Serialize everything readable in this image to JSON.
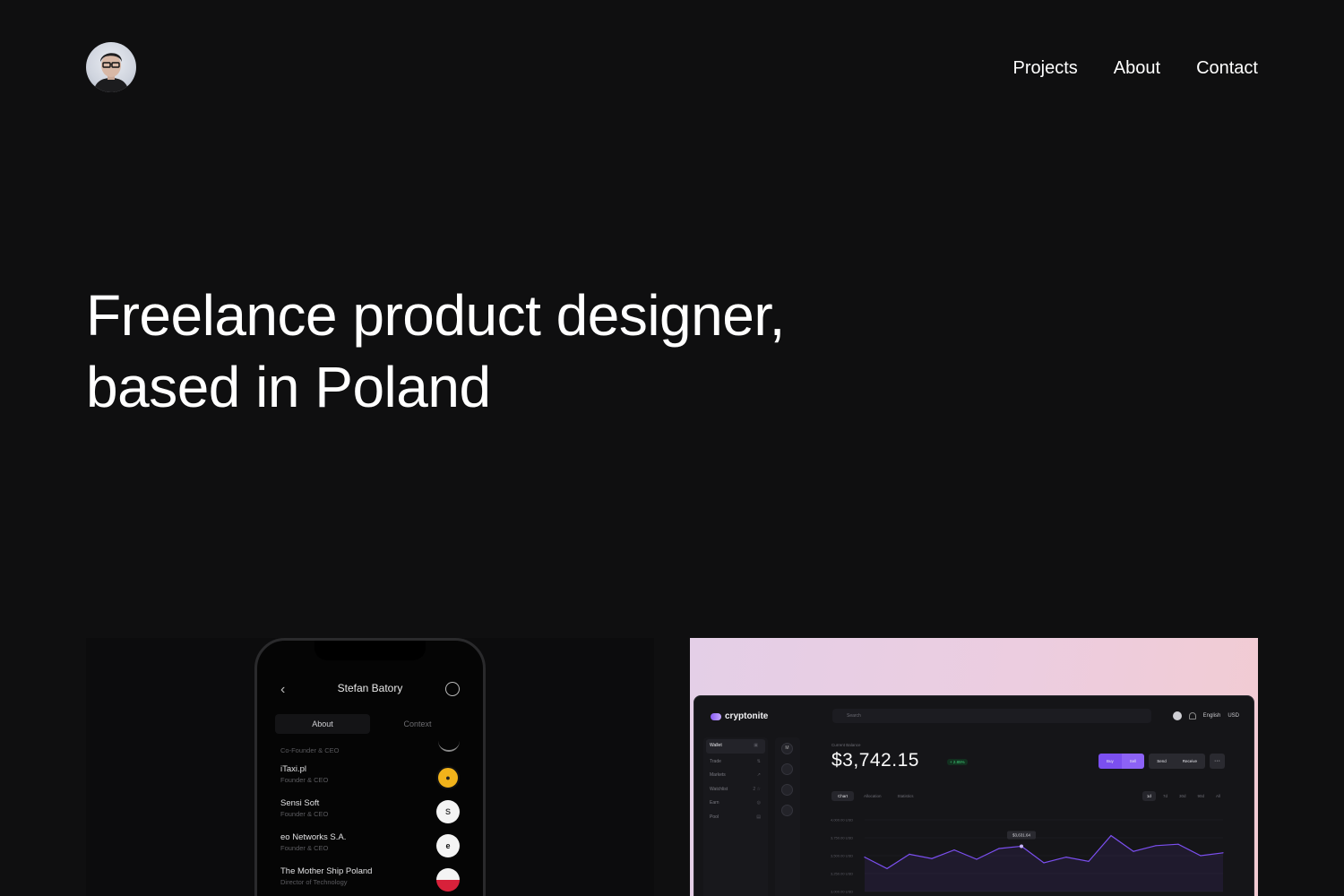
{
  "header": {
    "nav": [
      "Projects",
      "About",
      "Contact"
    ]
  },
  "hero": {
    "line1": "Freelance product designer,",
    "line2": "based in Poland"
  },
  "phone": {
    "title": "Stefan Batory",
    "tabs": [
      "About",
      "Context"
    ],
    "top_role": "Co-Founder & CEO",
    "items": [
      {
        "company": "iTaxi.pl",
        "role": "Founder & CEO",
        "logo": "itaxi-logo-icon"
      },
      {
        "company": "Sensi Soft",
        "role": "Founder & CEO",
        "logo": "sensi-soft-logo-icon"
      },
      {
        "company": "eo Networks S.A.",
        "role": "Founder & CEO",
        "logo": "eo-networks-logo-icon"
      },
      {
        "company": "The Mother Ship Poland",
        "role": "Director of Technology",
        "logo": "poland-flag-icon"
      }
    ]
  },
  "dashboard": {
    "brand": "cryptonite",
    "search_placeholder": "Search",
    "language": "English",
    "currency": "USD",
    "sidebar": [
      {
        "label": "Wallet",
        "active": true
      },
      {
        "label": "Trade",
        "active": false
      },
      {
        "label": "Markets",
        "active": false
      },
      {
        "label": "Watchlist",
        "active": false,
        "badge": "2"
      },
      {
        "label": "Earn",
        "active": false
      },
      {
        "label": "Pool",
        "active": false
      }
    ],
    "rail_top": "M",
    "balance_label": "Current Balance",
    "balance": "$3,742.15",
    "change": "+ 2.85%",
    "buttons": {
      "buy": "Buy",
      "sell": "Sell",
      "send": "Send",
      "receive": "Receive",
      "more": "···"
    },
    "tabs": [
      "Chart",
      "Allocation",
      "Statistics"
    ],
    "ranges": [
      "1d",
      "7d",
      "30d",
      "90d",
      "All"
    ],
    "tooltip": "$3,631.64",
    "y_labels": [
      "4,000.00 USD",
      "3,750.00 USD",
      "3,500.00 USD",
      "3,250.00 USD",
      "3,000.00 USD"
    ],
    "accent": "#7b4ff0"
  },
  "chart_data": {
    "type": "line",
    "title": "",
    "xlabel": "",
    "ylabel": "",
    "ylim": [
      3000,
      4000
    ],
    "x": [
      1,
      2,
      3,
      4,
      5,
      6,
      7,
      8,
      9,
      10,
      11,
      12,
      13,
      14,
      15,
      16,
      17
    ],
    "series": [
      {
        "values": [
          3480,
          3320,
          3520,
          3460,
          3580,
          3450,
          3600,
          3632,
          3400,
          3480,
          3420,
          3780,
          3560,
          3640,
          3660,
          3500,
          3540
        ]
      }
    ]
  }
}
